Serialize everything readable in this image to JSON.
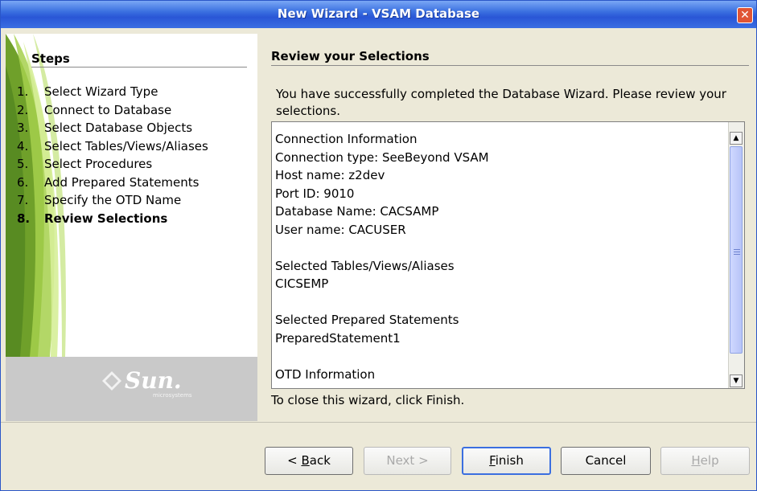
{
  "window": {
    "title": "New Wizard - VSAM Database",
    "close_glyph": "✕"
  },
  "steps": {
    "title": "Steps",
    "items": [
      {
        "num": "1.",
        "label": "Select Wizard Type"
      },
      {
        "num": "2.",
        "label": "Connect to Database"
      },
      {
        "num": "3.",
        "label": "Select Database Objects"
      },
      {
        "num": "4.",
        "label": "Select Tables/Views/Aliases"
      },
      {
        "num": "5.",
        "label": "Select Procedures"
      },
      {
        "num": "6.",
        "label": "Add Prepared Statements"
      },
      {
        "num": "7.",
        "label": "Specify the OTD Name"
      },
      {
        "num": "8.",
        "label": "Review Selections"
      }
    ],
    "active_index": 7
  },
  "logo": {
    "text": "Sun.",
    "subtext": "microsystems"
  },
  "review": {
    "title": "Review your Selections",
    "intro": "You have successfully completed the Database Wizard.  Please review your selections.",
    "lines": [
      "Connection Information",
      "Connection type: SeeBeyond VSAM",
      "Host name: z2dev",
      "Port ID: 9010",
      "Database Name: CACSAMP",
      "User name: CACUSER",
      "",
      "Selected Tables/Views/Aliases",
      "CICSEMP",
      "",
      "Selected Prepared Statements",
      "PreparedStatement1",
      "",
      "OTD Information"
    ],
    "close_hint": "To close this wizard, click Finish."
  },
  "buttons": {
    "back": {
      "prefix": "< ",
      "mnemonic": "B",
      "rest": "ack"
    },
    "next": "Next >",
    "finish": {
      "mnemonic": "F",
      "rest": "inish"
    },
    "cancel": "Cancel",
    "help": {
      "mnemonic": "H",
      "rest": "elp"
    }
  },
  "icons": {
    "scroll_up": "up-arrow-icon",
    "scroll_down": "down-arrow-icon",
    "close": "close-icon",
    "logo": "sun-diamond-icon"
  },
  "colors": {
    "titlebar": "#2956d6",
    "accent": "#3b6fe0",
    "leaf": "#7cb234"
  }
}
